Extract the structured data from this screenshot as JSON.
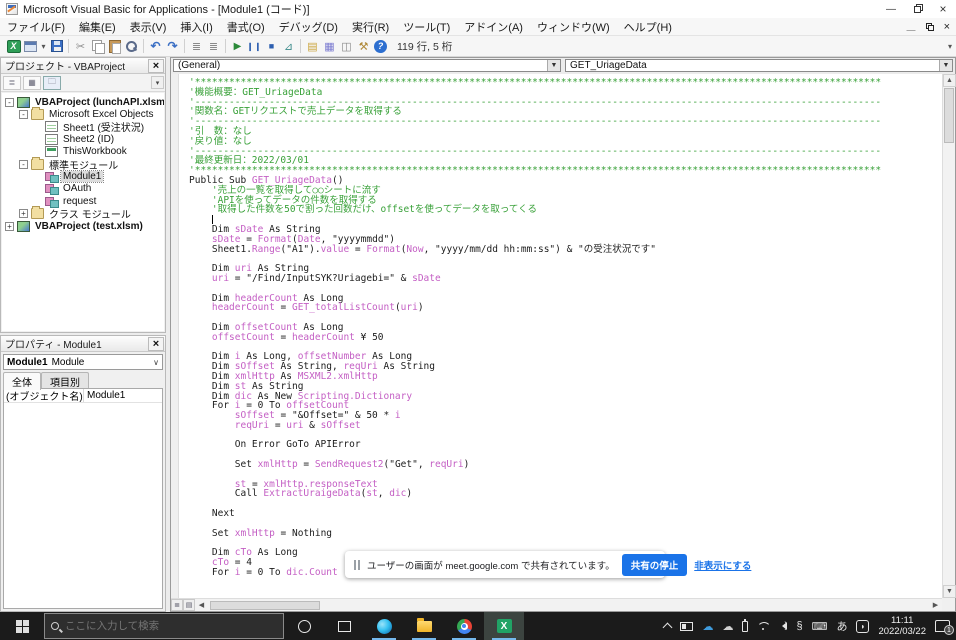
{
  "title_bar": {
    "title": "Microsoft Visual Basic for Applications - [Module1 (コード)]"
  },
  "menu_bar": {
    "items": [
      "ファイル(F)",
      "編集(E)",
      "表示(V)",
      "挿入(I)",
      "書式(O)",
      "デバッグ(D)",
      "実行(R)",
      "ツール(T)",
      "アドイン(A)",
      "ウィンドウ(W)",
      "ヘルプ(H)"
    ]
  },
  "toolbar": {
    "status": "119 行, 5 桁"
  },
  "project_panel": {
    "title": "プロジェクト - VBAProject",
    "tree": [
      {
        "label": "VBAProject (lunchAPI.xlsm)",
        "level": 0,
        "expand": "-",
        "icon": "project",
        "bold": true
      },
      {
        "label": "Microsoft Excel Objects",
        "level": 1,
        "expand": "-",
        "icon": "folder"
      },
      {
        "label": "Sheet1 (受注状況)",
        "level": 2,
        "expand": null,
        "icon": "sheet"
      },
      {
        "label": "Sheet2 (ID)",
        "level": 2,
        "expand": null,
        "icon": "sheet"
      },
      {
        "label": "ThisWorkbook",
        "level": 2,
        "expand": null,
        "icon": "workbook"
      },
      {
        "label": "標準モジュール",
        "level": 1,
        "expand": "-",
        "icon": "folder"
      },
      {
        "label": "Module1",
        "level": 2,
        "expand": null,
        "icon": "module",
        "selected": true
      },
      {
        "label": "OAuth",
        "level": 2,
        "expand": null,
        "icon": "module"
      },
      {
        "label": "request",
        "level": 2,
        "expand": null,
        "icon": "module"
      },
      {
        "label": "クラス モジュール",
        "level": 1,
        "expand": "+",
        "icon": "folder"
      },
      {
        "label": "VBAProject (test.xlsm)",
        "level": 0,
        "expand": "+",
        "icon": "project",
        "bold": true
      }
    ]
  },
  "properties_panel": {
    "title": "プロパティ - Module1",
    "selector_name": "Module1",
    "selector_type": "Module",
    "tabs": [
      "全体",
      "項目別"
    ],
    "rows": [
      {
        "name": "(オブジェクト名)",
        "value": "Module1"
      }
    ]
  },
  "code_window": {
    "proc_left": "(General)",
    "proc_right": "GET_UriageData",
    "lines": [
      [
        {
          "c": "com",
          "s": "'************************************************************************************************************************"
        }
      ],
      [
        {
          "c": "com",
          "s": "'機能概要：GET_UriageData"
        }
      ],
      [
        {
          "c": "com",
          "s": "'------------------------------------------------------------------------------------------------------------------------"
        }
      ],
      [
        {
          "c": "com",
          "s": "'関数名：GETリクエストで売上データを取得する"
        }
      ],
      [
        {
          "c": "com",
          "s": "'------------------------------------------------------------------------------------------------------------------------"
        }
      ],
      [
        {
          "c": "com",
          "s": "'引　数：なし"
        }
      ],
      [
        {
          "c": "com",
          "s": "'戻り値：なし"
        }
      ],
      [
        {
          "c": "com",
          "s": "'------------------------------------------------------------------------------------------------------------------------"
        }
      ],
      [
        {
          "c": "com",
          "s": "'最終更新日：2022/03/01"
        }
      ],
      [
        {
          "c": "com",
          "s": "'************************************************************************************************************************"
        }
      ],
      [
        {
          "c": "k",
          "s": "Public Sub "
        },
        {
          "c": "id",
          "s": "GET_UriageData"
        },
        {
          "c": "k",
          "s": "()"
        }
      ],
      [
        {
          "c": "com",
          "s": "    '売上の一覧を取得して○○シートに流す"
        }
      ],
      [
        {
          "c": "com",
          "s": "    'APIを使ってデータの件数を取得する"
        }
      ],
      [
        {
          "c": "com",
          "s": "    '取得した件数を50で割った回数だけ、offsetを使ってデータを取ってくる"
        }
      ],
      [
        {
          "c": "k",
          "s": "    "
        },
        {
          "c": "caret",
          "s": ""
        }
      ],
      [
        {
          "c": "k",
          "s": "    Dim "
        },
        {
          "c": "id",
          "s": "sDate"
        },
        {
          "c": "k",
          "s": " As String"
        }
      ],
      [
        {
          "c": "k",
          "s": "    "
        },
        {
          "c": "id",
          "s": "sDate"
        },
        {
          "c": "k",
          "s": " = "
        },
        {
          "c": "id",
          "s": "Format"
        },
        {
          "c": "k",
          "s": "("
        },
        {
          "c": "id",
          "s": "Date"
        },
        {
          "c": "k",
          "s": ", \"yyyymmdd\")"
        }
      ],
      [
        {
          "c": "k",
          "s": "    Sheet1."
        },
        {
          "c": "id",
          "s": "Range"
        },
        {
          "c": "k",
          "s": "(\"A1\")."
        },
        {
          "c": "id",
          "s": "value"
        },
        {
          "c": "k",
          "s": " = "
        },
        {
          "c": "id",
          "s": "Format"
        },
        {
          "c": "k",
          "s": "("
        },
        {
          "c": "id",
          "s": "Now"
        },
        {
          "c": "k",
          "s": ", \"yyyy/mm/dd hh:mm:ss\") & \"の受注状況です\""
        }
      ],
      [],
      [
        {
          "c": "k",
          "s": "    Dim "
        },
        {
          "c": "id",
          "s": "uri"
        },
        {
          "c": "k",
          "s": " As String"
        }
      ],
      [
        {
          "c": "k",
          "s": "    "
        },
        {
          "c": "id",
          "s": "uri"
        },
        {
          "c": "k",
          "s": " = \"/Find/InputSYK?Uriagebi=\" & "
        },
        {
          "c": "id",
          "s": "sDate"
        }
      ],
      [],
      [
        {
          "c": "k",
          "s": "    Dim "
        },
        {
          "c": "id",
          "s": "headerCount"
        },
        {
          "c": "k",
          "s": " As Long"
        }
      ],
      [
        {
          "c": "k",
          "s": "    "
        },
        {
          "c": "id",
          "s": "headerCount"
        },
        {
          "c": "k",
          "s": " = "
        },
        {
          "c": "id",
          "s": "GET_totalListCount"
        },
        {
          "c": "k",
          "s": "("
        },
        {
          "c": "id",
          "s": "uri"
        },
        {
          "c": "k",
          "s": ")"
        }
      ],
      [],
      [
        {
          "c": "k",
          "s": "    Dim "
        },
        {
          "c": "id",
          "s": "offsetCount"
        },
        {
          "c": "k",
          "s": " As Long"
        }
      ],
      [
        {
          "c": "k",
          "s": "    "
        },
        {
          "c": "id",
          "s": "offsetCount"
        },
        {
          "c": "k",
          "s": " = "
        },
        {
          "c": "id",
          "s": "headerCount"
        },
        {
          "c": "k",
          "s": " ¥ 50"
        }
      ],
      [],
      [
        {
          "c": "k",
          "s": "    Dim "
        },
        {
          "c": "id",
          "s": "i"
        },
        {
          "c": "k",
          "s": " As Long, "
        },
        {
          "c": "id",
          "s": "offsetNumber"
        },
        {
          "c": "k",
          "s": " As Long"
        }
      ],
      [
        {
          "c": "k",
          "s": "    Dim "
        },
        {
          "c": "id",
          "s": "sOffset"
        },
        {
          "c": "k",
          "s": " As String, "
        },
        {
          "c": "id",
          "s": "reqUri"
        },
        {
          "c": "k",
          "s": " As String"
        }
      ],
      [
        {
          "c": "k",
          "s": "    Dim "
        },
        {
          "c": "id",
          "s": "xmlHttp"
        },
        {
          "c": "k",
          "s": " As "
        },
        {
          "c": "id",
          "s": "MSXML2.xmlHttp"
        }
      ],
      [
        {
          "c": "k",
          "s": "    Dim "
        },
        {
          "c": "id",
          "s": "st"
        },
        {
          "c": "k",
          "s": " As String"
        }
      ],
      [
        {
          "c": "k",
          "s": "    Dim "
        },
        {
          "c": "id",
          "s": "dic"
        },
        {
          "c": "k",
          "s": " As New "
        },
        {
          "c": "id",
          "s": "Scripting.Dictionary"
        }
      ],
      [
        {
          "c": "k",
          "s": "    For "
        },
        {
          "c": "id",
          "s": "i"
        },
        {
          "c": "k",
          "s": " = 0 To "
        },
        {
          "c": "id",
          "s": "offsetCount"
        }
      ],
      [
        {
          "c": "k",
          "s": "        "
        },
        {
          "c": "id",
          "s": "sOffset"
        },
        {
          "c": "k",
          "s": " = \"&Offset=\" & 50 * "
        },
        {
          "c": "id",
          "s": "i"
        }
      ],
      [
        {
          "c": "k",
          "s": "        "
        },
        {
          "c": "id",
          "s": "reqUri"
        },
        {
          "c": "k",
          "s": " = "
        },
        {
          "c": "id",
          "s": "uri"
        },
        {
          "c": "k",
          "s": " & "
        },
        {
          "c": "id",
          "s": "sOffset"
        }
      ],
      [],
      [
        {
          "c": "k",
          "s": "        On Error GoTo APIError"
        }
      ],
      [],
      [
        {
          "c": "k",
          "s": "        Set "
        },
        {
          "c": "id",
          "s": "xmlHttp"
        },
        {
          "c": "k",
          "s": " = "
        },
        {
          "c": "id",
          "s": "SendRequest2"
        },
        {
          "c": "k",
          "s": "(\"Get\", "
        },
        {
          "c": "id",
          "s": "reqUri"
        },
        {
          "c": "k",
          "s": ")"
        }
      ],
      [],
      [
        {
          "c": "k",
          "s": "        "
        },
        {
          "c": "id",
          "s": "st"
        },
        {
          "c": "k",
          "s": " = "
        },
        {
          "c": "id",
          "s": "xmlHttp.responseText"
        }
      ],
      [
        {
          "c": "k",
          "s": "        Call "
        },
        {
          "c": "id",
          "s": "ExtractUraigeData"
        },
        {
          "c": "k",
          "s": "("
        },
        {
          "c": "id",
          "s": "st"
        },
        {
          "c": "k",
          "s": ", "
        },
        {
          "c": "id",
          "s": "dic"
        },
        {
          "c": "k",
          "s": ")"
        }
      ],
      [],
      [
        {
          "c": "k",
          "s": "    Next"
        }
      ],
      [],
      [
        {
          "c": "k",
          "s": "    Set "
        },
        {
          "c": "id",
          "s": "xmlHttp"
        },
        {
          "c": "k",
          "s": " = Nothing"
        }
      ],
      [],
      [
        {
          "c": "k",
          "s": "    Dim "
        },
        {
          "c": "id",
          "s": "cTo"
        },
        {
          "c": "k",
          "s": " As Long"
        }
      ],
      [
        {
          "c": "k",
          "s": "    "
        },
        {
          "c": "id",
          "s": "cTo"
        },
        {
          "c": "k",
          "s": " = 4"
        }
      ],
      [
        {
          "c": "k",
          "s": "    For "
        },
        {
          "c": "id",
          "s": "i"
        },
        {
          "c": "k",
          "s": " = 0 To "
        },
        {
          "c": "id",
          "s": "dic.Count"
        },
        {
          "c": "k",
          "s": " - 1"
        }
      ]
    ]
  },
  "notification": {
    "message": "ユーザーの画面が meet.google.com で共有されています。",
    "stop": "共有の停止",
    "hide": "非表示にする",
    "accent": "#1a73e8"
  },
  "taskbar": {
    "search_placeholder": "ここに入力して検索",
    "ime": "あ",
    "excel_label": "X",
    "clock_time": "11:11",
    "clock_date": "2022/03/22",
    "badge": "1"
  },
  "colors": {
    "comment": "#39a139",
    "identifier": "#c45fc4",
    "code": "#1c1c1c"
  }
}
